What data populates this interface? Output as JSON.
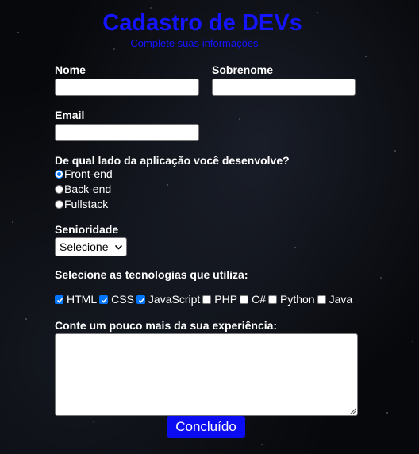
{
  "header": {
    "title": "Cadastro de DEVs",
    "subtitle": "Complete suas informações"
  },
  "form": {
    "first_name": {
      "label": "Nome",
      "value": ""
    },
    "last_name": {
      "label": "Sobrenome",
      "value": ""
    },
    "email": {
      "label": "Email",
      "value": ""
    },
    "side": {
      "question": "De qual lado da aplicação você desenvolve?",
      "options": [
        {
          "label": "Front-end",
          "selected": true
        },
        {
          "label": "Back-end",
          "selected": false
        },
        {
          "label": "Fullstack",
          "selected": false
        }
      ]
    },
    "seniority": {
      "label": "Senioridade",
      "selected": "Selecione"
    },
    "technologies": {
      "label": "Selecione as tecnologias que utiliza:",
      "items": [
        {
          "label": "HTML",
          "checked": true
        },
        {
          "label": "CSS",
          "checked": true
        },
        {
          "label": "JavaScript",
          "checked": true
        },
        {
          "label": "PHP",
          "checked": false
        },
        {
          "label": "C#",
          "checked": false
        },
        {
          "label": "Python",
          "checked": false
        },
        {
          "label": "Java",
          "checked": false
        }
      ]
    },
    "experience": {
      "label": "Conte um pouco mais da sua experiência:",
      "value": ""
    },
    "submit_label": "Concluído"
  },
  "colors": {
    "title": "#1414ff",
    "button": "#0c0cf2",
    "accent": "#0075ff"
  }
}
